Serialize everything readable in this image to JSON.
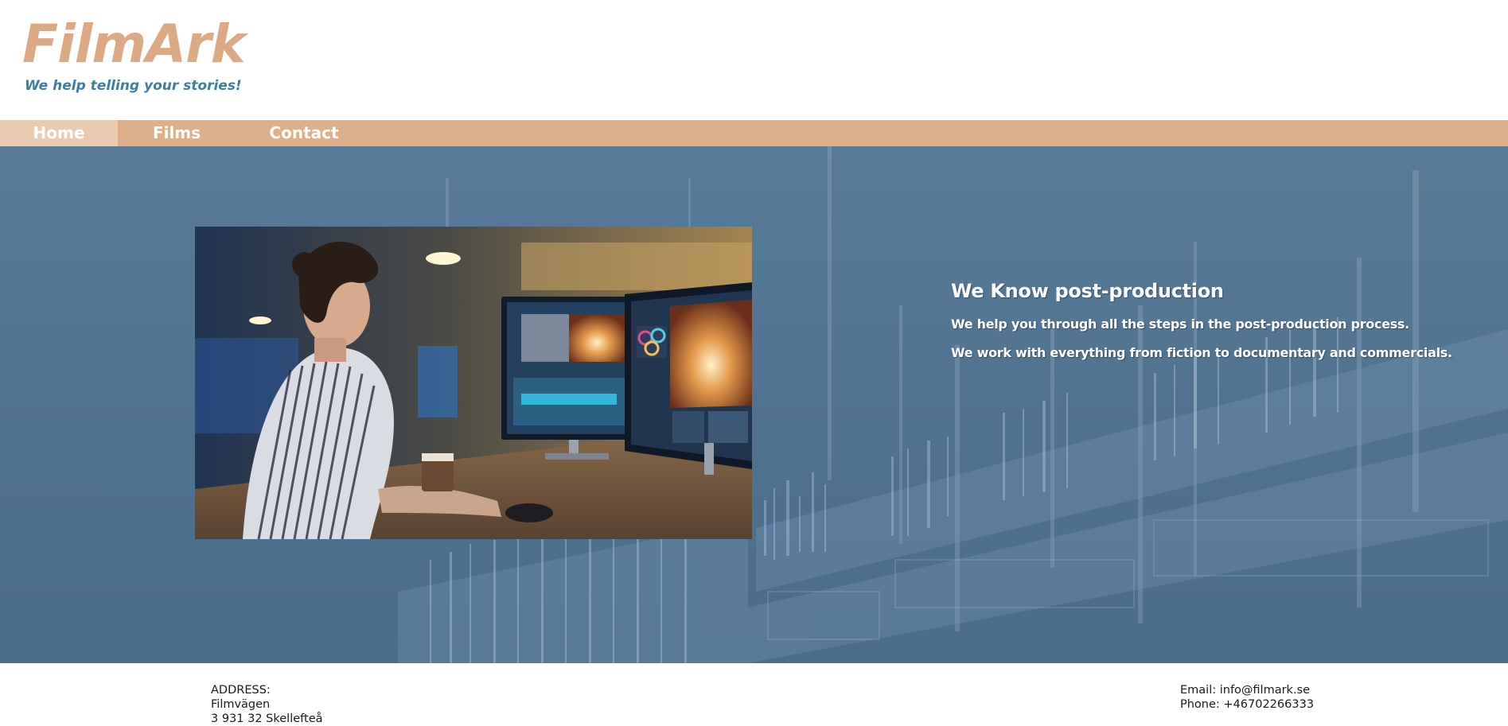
{
  "brand": {
    "logo_text": "FilmArk",
    "tagline": "We help telling your stories!",
    "logo_color": "#dca984",
    "tagline_color": "#3e7ea6"
  },
  "nav": {
    "items": [
      {
        "label": "Home",
        "active": true
      },
      {
        "label": "Films",
        "active": false
      },
      {
        "label": "Contact",
        "active": false
      }
    ],
    "bar_color": "#deaf88",
    "active_color": "#ebcbb0"
  },
  "hero": {
    "image_icon": "editor-at-workstation-photo",
    "background_icon": "editing-timeline-background",
    "background_color": "#4f7290",
    "title": "We Know post-production",
    "paragraphs": [
      "We help you through all the steps in the post-production process.",
      "We work with everything from fiction to documentary and commercials."
    ]
  },
  "footer": {
    "address_heading": "ADDRESS:",
    "address_street": "Filmvägen",
    "address_city": "3 931 32 Skellefteå",
    "email": "Email: info@filmark.se",
    "phone": "Phone: +46702266333"
  }
}
